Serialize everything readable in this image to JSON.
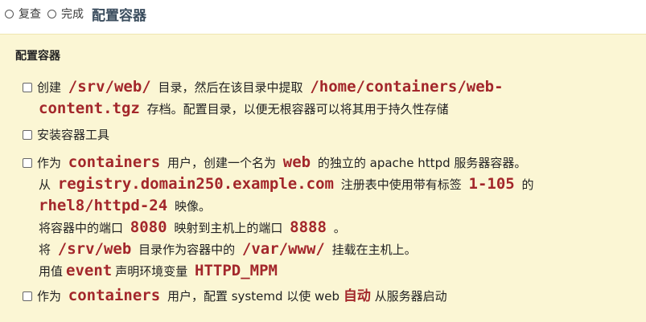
{
  "topbar": {
    "review_label": "复查",
    "done_label": "完成",
    "title": "配置容器"
  },
  "panel": {
    "heading": "配置容器"
  },
  "tasks": [
    {
      "p1": "创建",
      "c1": "/srv/web/",
      "p2": "目录，然后在该目录中提取",
      "c2": "/home/containers/web-",
      "c3": "content.tgz",
      "p3": "存档。配置目录，以便无根容器可以将其用于持久性存储"
    },
    {
      "p1": "安装容器工具"
    },
    {
      "l1_a": "作为",
      "l1_c1": "containers",
      "l1_b": "用户，创建一个名为",
      "l1_c2": "web",
      "l1_c": "的独立的 apache httpd 服务器容器。",
      "l2_a": "从",
      "l2_c1": "registry.domain250.example.com",
      "l2_b": "注册表中使用带有标签",
      "l2_c2": "1-105",
      "l2_c": "的",
      "l3_c1": "rhel8/httpd-24",
      "l3_a": "映像。",
      "l4_a": "将容器中的端口",
      "l4_c1": "8080",
      "l4_b": "映射到主机上的端口",
      "l4_c2": "8888",
      "l4_c": "。",
      "l5_a": "将",
      "l5_c1": "/srv/web",
      "l5_b": "目录作为容器中的",
      "l5_c2": "/var/www/",
      "l5_c": "挂载在主机上。",
      "l6_a": "用值",
      "l6_c1": "event",
      "l6_b": "声明环境变量",
      "l6_c2": "HTTPD_MPM"
    },
    {
      "p1": "作为",
      "c1": "containers",
      "p2": "用户，配置 systemd 以使 web",
      "h1": "自动",
      "p3": "从服务器启动"
    }
  ]
}
